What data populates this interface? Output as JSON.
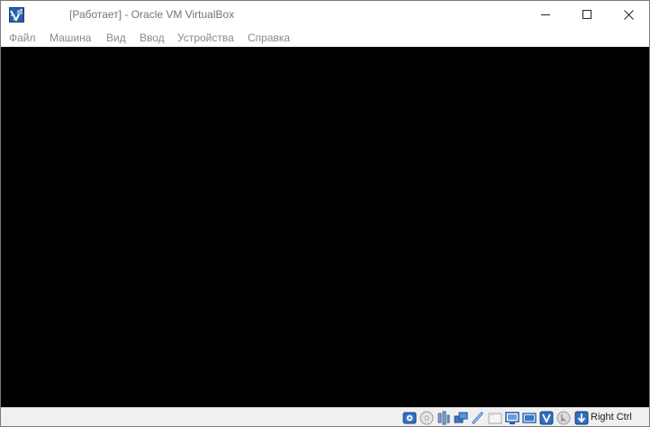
{
  "window": {
    "title": "[Работает] - Oracle VM VirtualBox"
  },
  "menu": {
    "items": [
      "Файл",
      "Машина",
      "Вид",
      "Ввод",
      "Устройства",
      "Справка"
    ]
  },
  "statusbar": {
    "icons": [
      "hard-disk-icon",
      "optical-drive-icon",
      "audio-icon",
      "network-icon",
      "usb-icon",
      "shared-folders-icon",
      "display-icon",
      "video-capture-icon",
      "virtualization-icon",
      "mouse-integration-icon",
      "keyboard-capture-icon"
    ],
    "host_key": "Right Ctrl"
  },
  "colors": {
    "screen": "#000000",
    "titlebar": "#ffffff",
    "statusbar": "#f0f0f0",
    "accent": "#1c5ca8"
  }
}
